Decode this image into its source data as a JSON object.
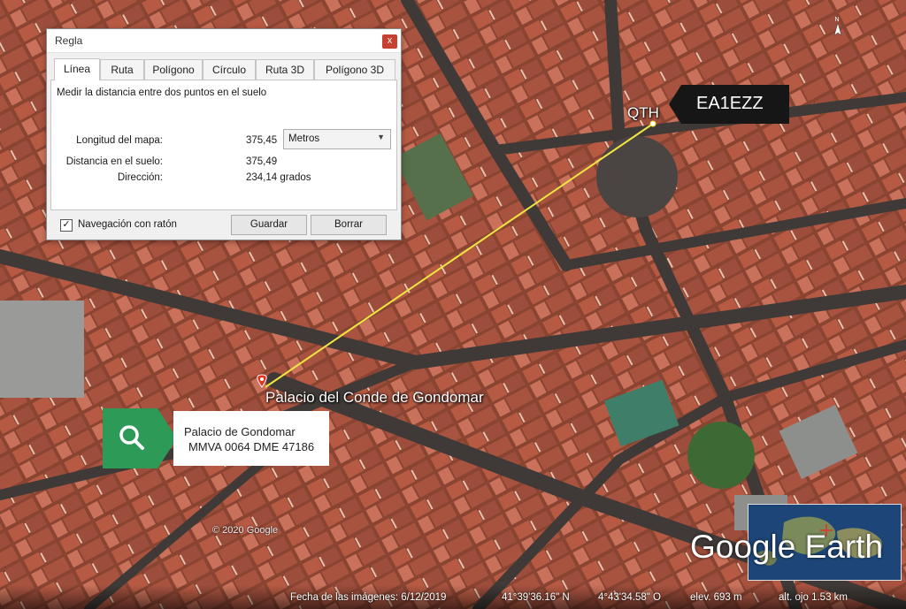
{
  "dialog": {
    "title": "Regla",
    "close": "x",
    "tabs": [
      "Línea",
      "Ruta",
      "Polígono",
      "Círculo",
      "Ruta 3D",
      "Polígono 3D"
    ],
    "description": "Medir la distancia entre dos puntos en el suelo",
    "map_length_label": "Longitud del mapa:",
    "map_length_value": "375,45",
    "unit_selected": "Metros",
    "ground_distance_label": "Distancia en el suelo:",
    "ground_distance_value": "375,49",
    "direction_label": "Dirección:",
    "direction_value": "234,14 grados",
    "mouse_nav_label": "Navegación con ratón",
    "mouse_nav_checked": "✓",
    "save_label": "Guardar",
    "clear_label": "Borrar"
  },
  "map": {
    "qth_label": "QTH",
    "callsign": "EA1EZZ",
    "place_label": "Palacio del Conde de Gondomar",
    "search_line1": "Palacio de Gondomar",
    "search_line2": "MMVA 0064 DME 47186",
    "copyright": "© 2020 Google",
    "brand": "Google Earth",
    "measure_line_color": "#f2e640"
  },
  "status": {
    "imagery_date": "Fecha de las imágenes: 6/12/2019",
    "lat": "41°39'36.16\" N",
    "lon": "4°43'34.58\" O",
    "elev": "elev.   693 m",
    "eye_alt": "alt. ojo   1.53 km"
  }
}
